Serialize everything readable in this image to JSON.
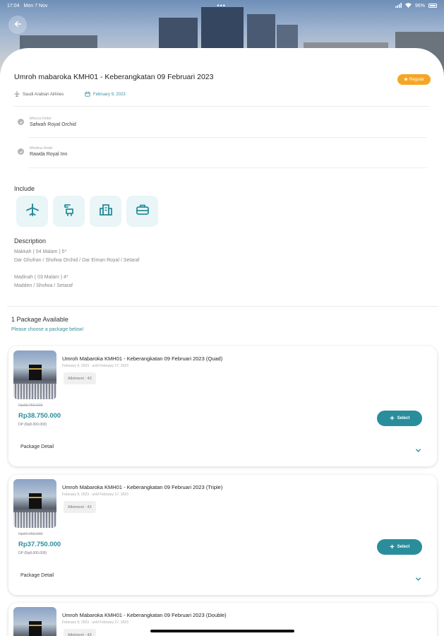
{
  "status_bar": {
    "time": "17:04",
    "date": "Mon 7 Nov",
    "dots": "•••",
    "battery": "96%"
  },
  "trip": {
    "title": "Umroh mabaroka KMH01 - Keberangkatan 09 Februari 2023",
    "badge": "Regular",
    "airline": "Saudi Arabian Airlines",
    "date": "February 9, 2023"
  },
  "hotels": [
    {
      "label": "Mecca Hotel",
      "name": "Safwah Royal Orchid"
    },
    {
      "label": "Medina Hotel",
      "name": "Rawda Royal Inn"
    }
  ],
  "include": {
    "heading": "Include",
    "items": [
      "plane-icon",
      "transport-icon",
      "hotel-icon",
      "luggage-icon"
    ]
  },
  "description": {
    "heading": "Description",
    "lines": [
      "Makkah ( 04 Malam ) 5*",
      "Dar Ghufran / Shofwa Orchid /  Dar Eiman Royal / Setaraf",
      "Madinah ( 03 Malam ) 4*",
      "Madden / Shofwa / Setaraf"
    ]
  },
  "packages_header": {
    "count": "1 Package Available",
    "hint": "Please choose a package below!"
  },
  "packages": [
    {
      "name": "Umroh Mabaroka KMH01 - Keberangkatan 09 Februari 2023 (Quad)",
      "dates": "February 9, 2023 · until February 17, 2023",
      "allotment": "Allotment : 43",
      "old_price": "Rp38.750.000",
      "price": "Rp38.750.000",
      "dp": "DP (Rp8.000.000)",
      "select": "Select",
      "detail": "Package Detail"
    },
    {
      "name": "Umroh Mabaroka KMH01 - Keberangkatan 09 Februari 2023 (Triple)",
      "dates": "February 9, 2023 · until February 17, 2023",
      "allotment": "Allotment : 43",
      "old_price": "Rp37.750.000",
      "price": "Rp37.750.000",
      "dp": "DP (Rp8.000.000)",
      "select": "Select",
      "detail": "Package Detail"
    },
    {
      "name": "Umroh Mabaroka KMH01 - Keberangkatan 09 Februari 2023 (Double)",
      "dates": "February 9, 2023 · until February 17, 2023",
      "allotment": "Allotment : 43"
    }
  ],
  "colors": {
    "accent": "#2a8d9c",
    "badge": "#f5a623",
    "include_bg": "#e9f5f7"
  }
}
